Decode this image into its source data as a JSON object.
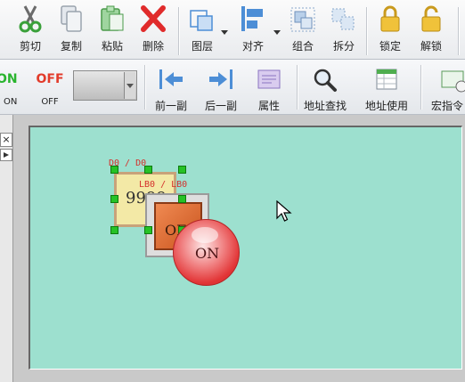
{
  "toolbar_main": {
    "cut": "剪切",
    "copy": "复制",
    "paste": "粘贴",
    "delete": "删除",
    "layer": "图层",
    "align": "对齐",
    "group": "组合",
    "ungroup": "拆分",
    "lock": "锁定",
    "unlock": "解锁"
  },
  "toolbar_objects": {
    "on_icon_text": "ON",
    "off_icon_text": "OFF",
    "on_label": "ON",
    "off_label": "OFF",
    "prev": "前一副",
    "next": "后一副",
    "properties": "属性",
    "address_find": "地址查找",
    "address_use": "地址使用",
    "macro": "宏指令"
  },
  "left_panel": {
    "close": "×"
  },
  "canvas": {
    "number_object": {
      "tag": "D0 / D0",
      "value": "9999"
    },
    "off_button": {
      "tag": "LB0 / LB0",
      "label": "OFF"
    },
    "on_button": {
      "label": "ON"
    }
  },
  "colors": {
    "canvas_bg": "#9de0cf",
    "handle": "#26c226",
    "tag_text": "#d4302c"
  }
}
